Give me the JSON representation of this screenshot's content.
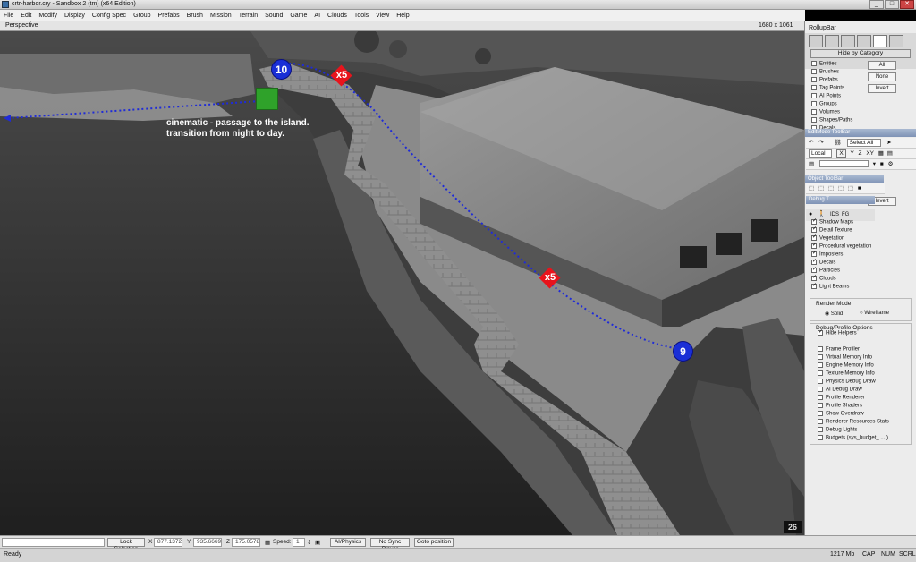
{
  "window": {
    "title": "crtr-harbor.cry - Sandbox 2 (tm) (x64 Edition)",
    "min": "_",
    "max": "□",
    "close": "✕"
  },
  "menu": [
    "File",
    "Edit",
    "Modify",
    "Display",
    "Config Spec",
    "Group",
    "Prefabs",
    "Brush",
    "Mission",
    "Terrain",
    "Sound",
    "Game",
    "AI",
    "Clouds",
    "Tools",
    "View",
    "Help"
  ],
  "viewport": {
    "name": "Perspective",
    "resolution": "1680 x 1061",
    "annotation_line1": "cinematic - passage to the island.",
    "annotation_line2": "transition from night to day.",
    "marker_start": "10",
    "marker_end": "9",
    "diamond1": "x5",
    "diamond2": "x5",
    "fps": "26"
  },
  "rollup": {
    "title": "RollupBar",
    "hide_by_category": "Hide by Category",
    "categories": [
      {
        "label": "Entities",
        "checked": false
      },
      {
        "label": "Brushes",
        "checked": false
      },
      {
        "label": "Prefabs",
        "checked": false
      },
      {
        "label": "Tag Points",
        "checked": false
      },
      {
        "label": "AI Points",
        "checked": false
      },
      {
        "label": "Groups",
        "checked": false
      },
      {
        "label": "Volumes",
        "checked": false
      },
      {
        "label": "Shapes/Paths",
        "checked": false
      },
      {
        "label": "Decals",
        "checked": false
      }
    ],
    "btn_all": "All",
    "btn_none": "None",
    "btn_invert": "Invert",
    "btn_invert2": "Invert",
    "editmode_title": "EditMode ToolBar",
    "select_all": "Select All",
    "coord_local": "Local",
    "axis_x": "X",
    "axis_y": "Y",
    "axis_z": "Z",
    "axis_xy": "XY",
    "object_toolbar_title": "Object ToolBar",
    "debug_toolbar_title": "Debug T",
    "debug_ids": "IDS",
    "debug_fg": "FG",
    "debug_items": [
      {
        "label": "Shadow Maps",
        "checked": true
      },
      {
        "label": "Detail Texture",
        "checked": true
      },
      {
        "label": "Vegetation",
        "checked": true
      },
      {
        "label": "Procedural vegetation",
        "checked": true
      },
      {
        "label": "Imposters",
        "checked": true
      },
      {
        "label": "Decals",
        "checked": true
      },
      {
        "label": "Particles",
        "checked": true
      },
      {
        "label": "Clouds",
        "checked": true
      },
      {
        "label": "Light Beams",
        "checked": true
      }
    ],
    "render_mode_label": "Render Mode",
    "render_solid": "Solid",
    "render_wireframe": "Wireframe",
    "debug_profile_label": "Debug/Profile Options",
    "hide_helpers": "Hide Helpers",
    "profile_items": [
      "Frame Profiler",
      "Virtual Memory Info",
      "Engine Memory Info",
      "Texture Memory Info",
      "Physics Debug Draw",
      "AI Debug Draw",
      "Profile Renderer",
      "Profile Shaders",
      "Show Overdraw",
      "Renderer Resources Stats",
      "Debug Lights",
      "Budgets (sys_budget_ ....)"
    ]
  },
  "bottom": {
    "lock_selection": "Lock Selection",
    "x_label": "X",
    "x_value": "877.1372",
    "y_label": "Y",
    "y_value": "935.6669",
    "z_label": "Z",
    "z_value": "175.0578",
    "speed_label": "Speed:",
    "speed_value": "1",
    "ai_physics": "AI/Physics",
    "no_sync_player": "No Sync Player",
    "goto_position": "Goto position"
  },
  "status": {
    "ready": "Ready",
    "memory": "1217 Mb",
    "cap": "CAP",
    "num": "NUM",
    "scrl": "SCRL"
  }
}
